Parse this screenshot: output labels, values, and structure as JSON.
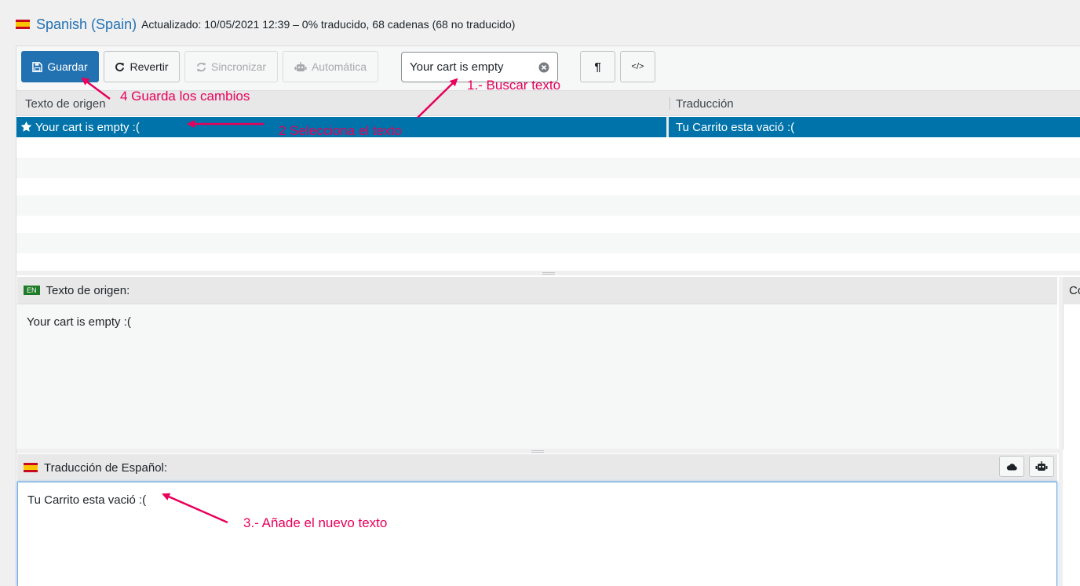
{
  "header": {
    "language": "Spanish (Spain)",
    "meta": "Actualizado: 10/05/2021 12:39 – 0% traducido, 68 cadenas (68 no traducido)"
  },
  "toolbar": {
    "save_label": "Guardar",
    "revert_label": "Revertir",
    "sync_label": "Sincronizar",
    "auto_label": "Automática",
    "search_value": "Your cart is empty",
    "invisibles_glyph": "¶",
    "code_glyph": "</>"
  },
  "list": {
    "col_source": "Texto de origen",
    "col_translation": "Traducción",
    "rows": [
      {
        "source": "Your cart is empty :(",
        "translation": "Tu Carrito esta vació :("
      }
    ]
  },
  "source_pane": {
    "badge": "EN",
    "title": "Texto de origen:",
    "text": "Your cart is empty :("
  },
  "side_pane": {
    "title": "Co"
  },
  "translation_pane": {
    "title": "Traducción de Español:",
    "text": "Tu Carrito esta vació :("
  },
  "annotations": {
    "step1": "1.- Buscar texto",
    "step2": "2 Selecciona el texto",
    "step3": "3.- Añade el nuevo texto",
    "step4": "4 Guarda los cambios"
  },
  "colors": {
    "accent": "#2271b1",
    "selected_row": "#0073aa",
    "annotation": "#e8005a"
  },
  "icons": {
    "save": "floppy-icon",
    "revert": "undo-icon",
    "sync": "refresh-icon",
    "auto": "robot-icon",
    "clear": "clear-icon",
    "star": "star-icon",
    "cloud": "cloud-icon"
  }
}
